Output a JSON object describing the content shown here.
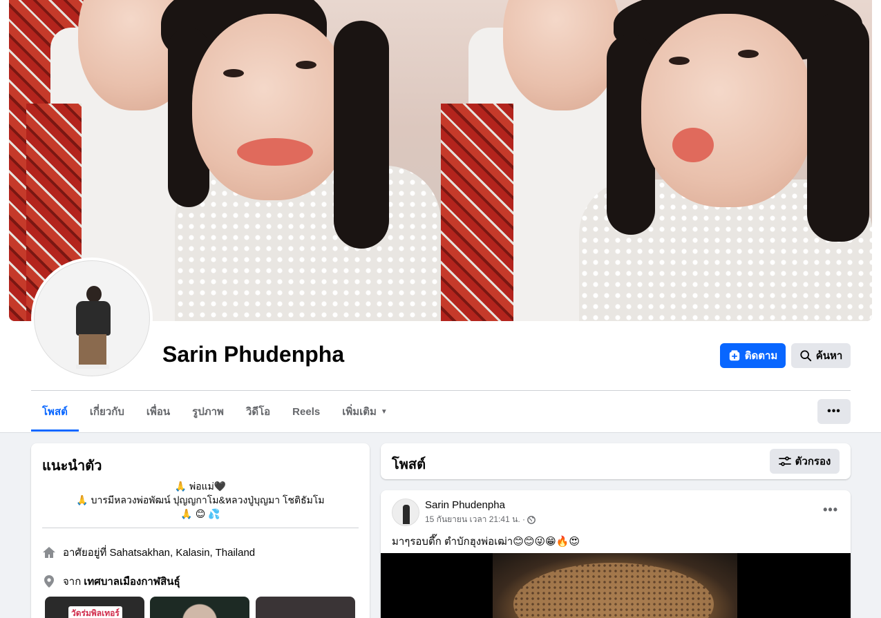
{
  "profile": {
    "name": "Sarin Phudenpha",
    "follow_label": "ติดตาม",
    "search_label": "ค้นหา"
  },
  "tabs": [
    {
      "label": "โพสต์",
      "active": true
    },
    {
      "label": "เกี่ยวกับ"
    },
    {
      "label": "เพื่อน"
    },
    {
      "label": "รูปภาพ"
    },
    {
      "label": "วิดีโอ"
    },
    {
      "label": "Reels"
    },
    {
      "label": "เพิ่มเติม"
    }
  ],
  "more_label": "•••",
  "intro": {
    "title": "แนะนำตัว",
    "bio_line1": "🙏 พ่อแม่🖤",
    "bio_line2": "🙏 บารมีหลวงพ่อพัฒน์ ปุญญกาโม&หลวงปู่บุญมา โชติธัมโม",
    "bio_line3": "🙏 😊 💦",
    "lives_prefix": "อาศัยอยู่ที่",
    "lives_value": "Sahatsakhan, Kalasin, Thailand",
    "from_prefix": "จาก",
    "from_value": "เทศบาลเมืองกาฬสินธุ์",
    "thumb1_text": "วัดร่มพิลเทอร์"
  },
  "posts_header": {
    "title": "โพสต์",
    "filter_label": "ตัวกรอง"
  },
  "post": {
    "author": "Sarin Phudenpha",
    "time": "15 กันยายน เวลา 21:41 น. ·",
    "more": "•••",
    "text": "มาๆรอบตึ๊ก ตำบักฮุงพ่อเฒ่า😊😊😜😁🔥😍"
  },
  "colors": {
    "accent": "#0866ff",
    "page_bg": "#f0f2f5",
    "secondary_btn": "#e4e6eb"
  }
}
